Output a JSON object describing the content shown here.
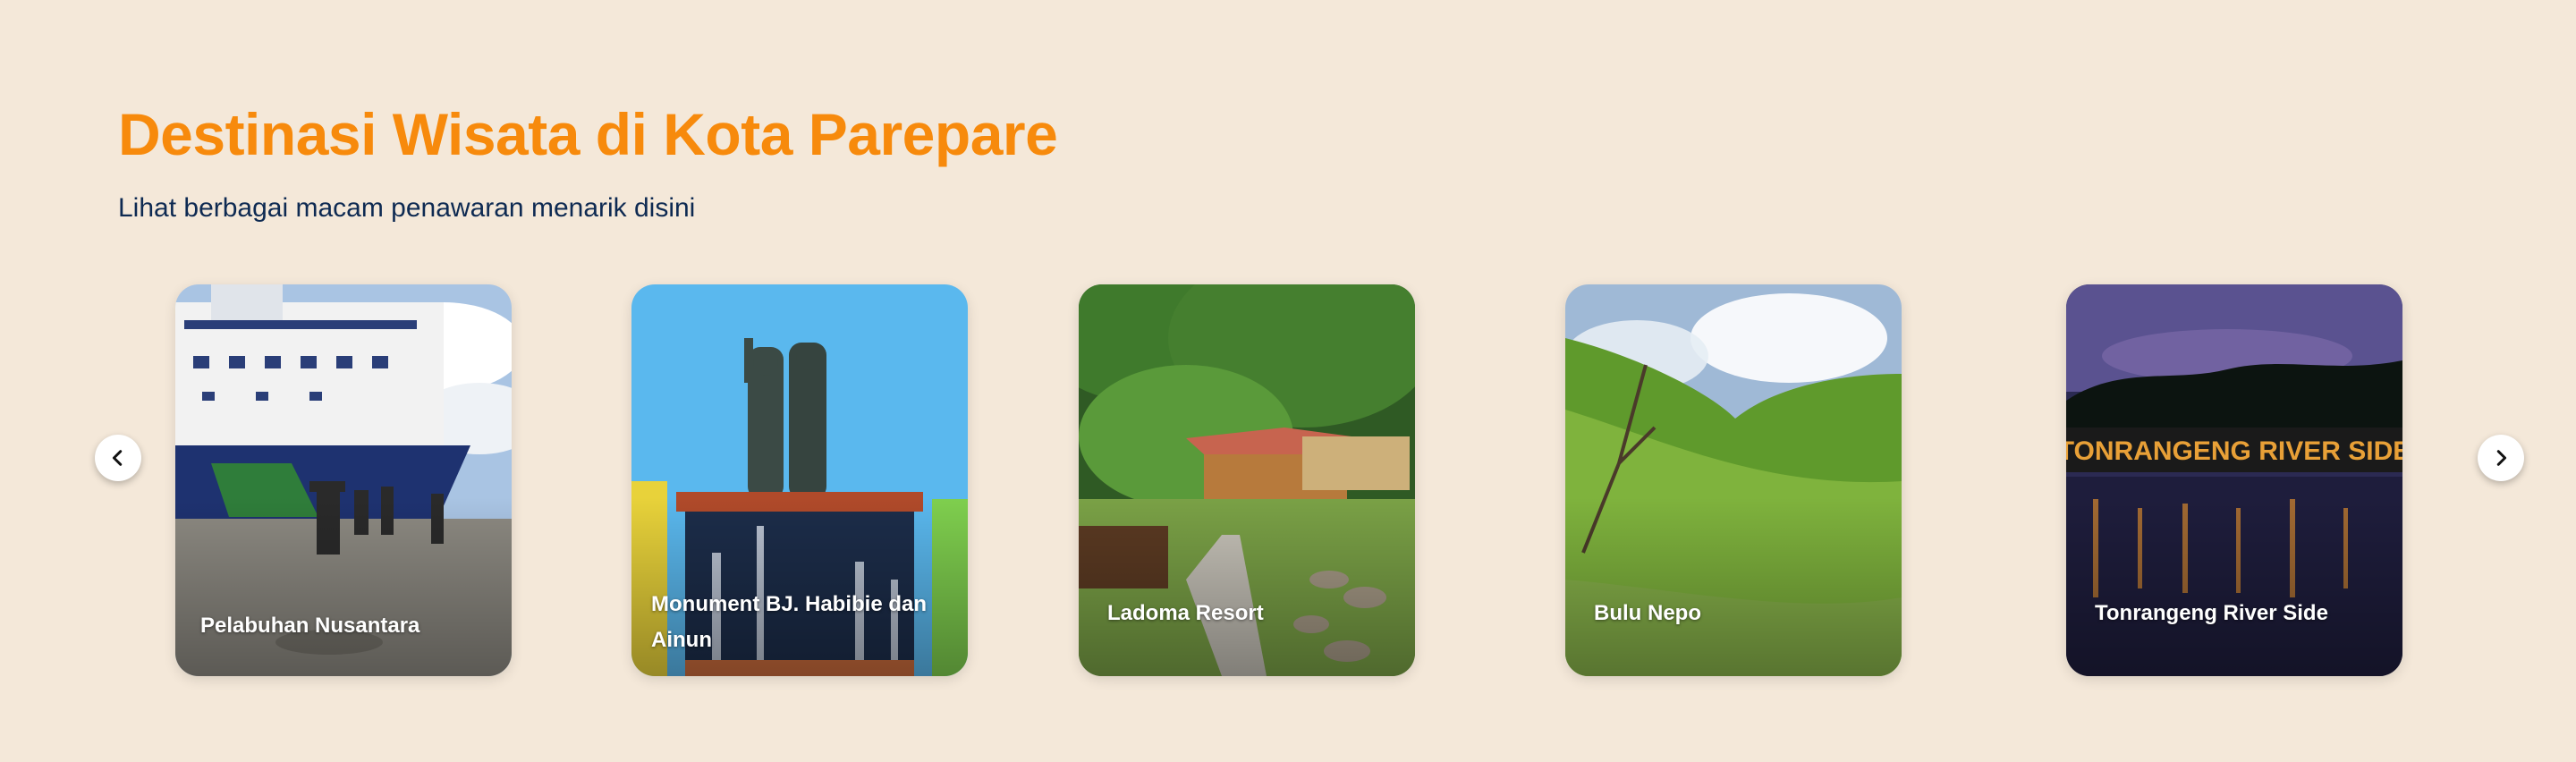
{
  "section": {
    "title": "Destinasi Wisata di Kota Parepare",
    "subtitle": "Lihat berbagai macam penawaran menarik disini"
  },
  "carousel": {
    "prev_icon": "chevron-left-icon",
    "next_icon": "chevron-right-icon",
    "items": [
      {
        "label": "Pelabuhan Nusantara",
        "photo": "ship-at-harbor"
      },
      {
        "label": "Monument BJ. Habibie dan Ainun",
        "photo": "bronze-statue-fountain"
      },
      {
        "label": "Ladoma Resort",
        "photo": "forest-resort-huts"
      },
      {
        "label": "Bulu Nepo",
        "photo": "green-hills"
      },
      {
        "label": "Tonrangeng River Side",
        "photo": "night-river-sign"
      }
    ]
  },
  "photo_text": {
    "river_sign": "TONRANGENG RIVER SIDE"
  }
}
